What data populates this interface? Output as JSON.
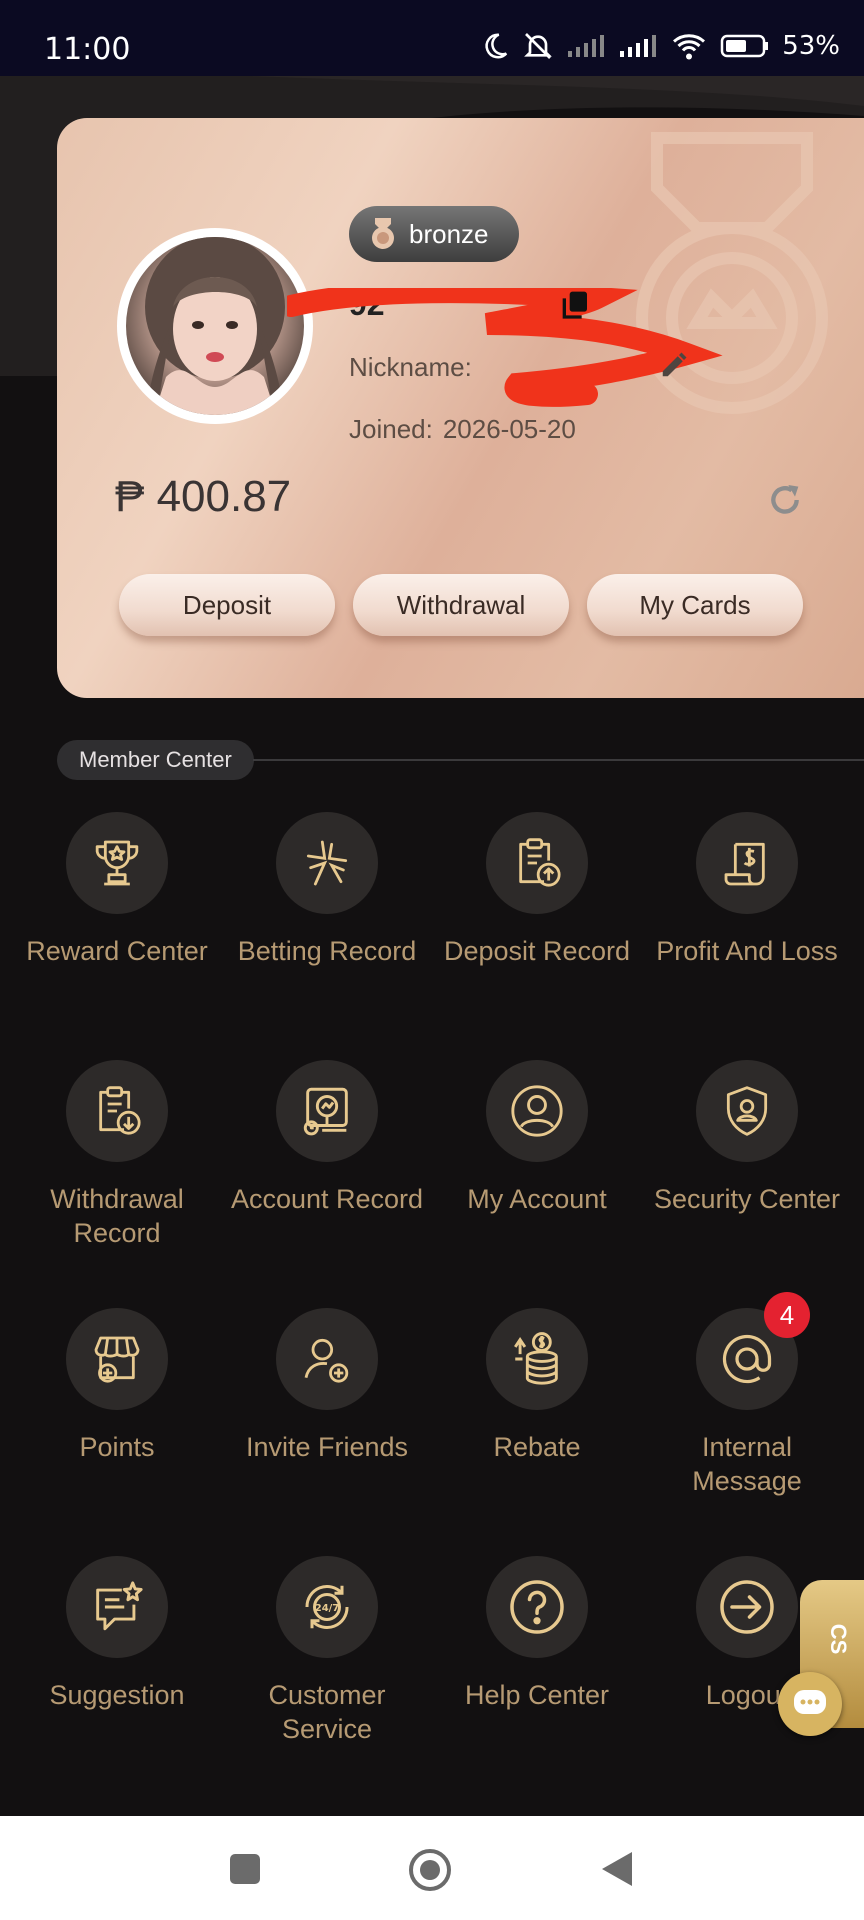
{
  "status_bar": {
    "time": "11:00",
    "battery": "53%",
    "icons": [
      "moon-icon",
      "bell-off-icon",
      "signal-icon",
      "signal-icon",
      "wifi-icon",
      "battery-icon"
    ]
  },
  "profile": {
    "vip_level": "bronze",
    "user_id": "92",
    "nickname_label": "Nickname:",
    "joined_label": "Joined:",
    "joined_date": "2026-05-20",
    "balance": "₱ 400.87"
  },
  "actions": {
    "deposit": "Deposit",
    "withdrawal": "Withdrawal",
    "my_cards": "My Cards"
  },
  "member_center": {
    "title": "Member Center",
    "items": [
      {
        "label": "Reward Center",
        "icon": "trophy-icon"
      },
      {
        "label": "Betting Record",
        "icon": "stars-icon"
      },
      {
        "label": "Deposit Record",
        "icon": "clipboard-upload-icon"
      },
      {
        "label": "Profit And Loss",
        "icon": "receipt-dollar-icon"
      },
      {
        "label": "Withdrawal Record",
        "icon": "clipboard-download-icon"
      },
      {
        "label": "Account Record",
        "icon": "account-record-icon"
      },
      {
        "label": "My Account",
        "icon": "user-circle-icon"
      },
      {
        "label": "Security Center",
        "icon": "shield-user-icon"
      },
      {
        "label": "Points",
        "icon": "shop-icon"
      },
      {
        "label": "Invite Friends",
        "icon": "add-user-icon"
      },
      {
        "label": "Rebate",
        "icon": "coins-icon"
      },
      {
        "label": "Internal Message",
        "icon": "at-sign-icon",
        "badge": "4"
      },
      {
        "label": "Suggestion",
        "icon": "feedback-icon"
      },
      {
        "label": "Customer Service",
        "icon": "support-24-7-icon"
      },
      {
        "label": "Help Center",
        "icon": "help-icon"
      },
      {
        "label": "Logout",
        "icon": "logout-icon"
      }
    ]
  },
  "floating": {
    "cs_label": "CS"
  },
  "colors": {
    "accent_gold": "#b69a73",
    "badge_red": "#e42230",
    "background": "#121011"
  }
}
